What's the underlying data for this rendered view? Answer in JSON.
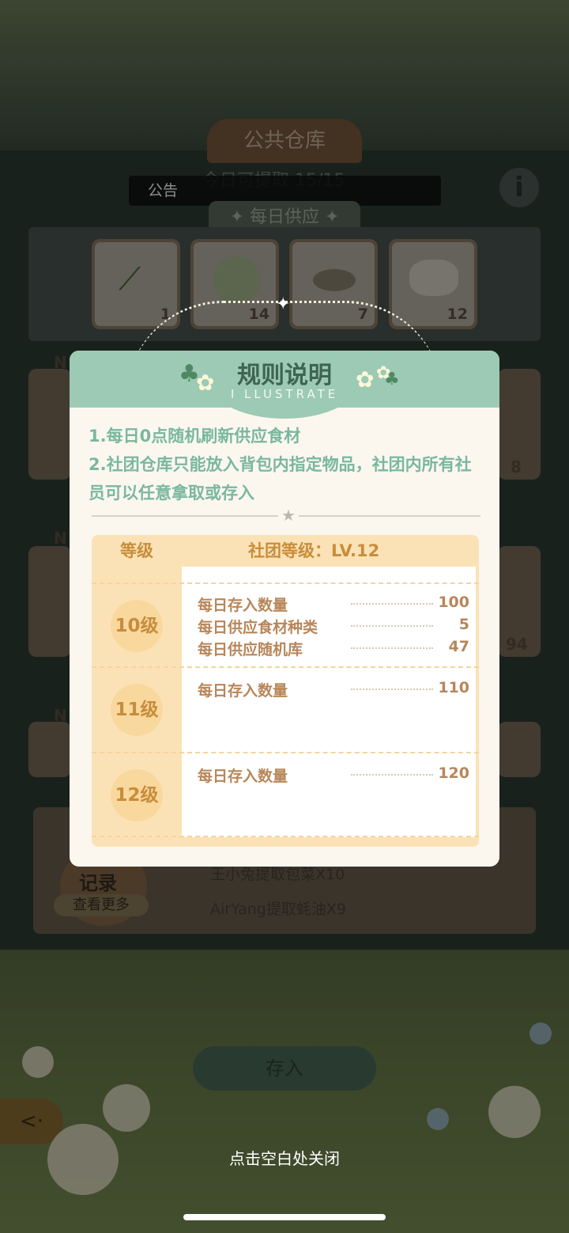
{
  "background": {
    "title": "公共仓库",
    "today_text": "今日可提取 15/15",
    "notice_label": "公告",
    "info_icon": "i",
    "supply_tab": "✦ 每日供应 ✦",
    "supply_slots": [
      {
        "icon": "leek-icon",
        "count": "1"
      },
      {
        "icon": "cabbage-icon",
        "count": "14"
      },
      {
        "icon": "sauce-bowl-icon",
        "count": "7"
      },
      {
        "icon": "cauliflower-icon",
        "count": "12"
      }
    ],
    "side_counts": {
      "left_a": "N",
      "left_b": "N",
      "left_c": "N",
      "right_a": "8",
      "right_b": "94"
    },
    "log_title": "记录",
    "log_more": "查看更多",
    "log_lines": [
      "王小兔提取包菜X10",
      "AirYang提取蚝油X9"
    ],
    "deposit_label": "存入",
    "back_icon": "back-arrow-icon"
  },
  "modal": {
    "title": "规则说明",
    "subtitle": "I LLUSTRATE",
    "rules": [
      "1.每日0点随机刷新供应食材",
      "2.社团仓库只能放入背包内指定物品，社团内所有社员可以任意拿取或存入"
    ],
    "table": {
      "header_level": "等级",
      "header_club": "社团等级：LV.12",
      "rows": [
        {
          "level": "10级",
          "items": [
            {
              "label": "每日存入数量",
              "value": "100"
            },
            {
              "label": "每日供应食材种类",
              "value": "5"
            },
            {
              "label": "每日供应随机库",
              "value": "47"
            }
          ]
        },
        {
          "level": "11级",
          "items": [
            {
              "label": "每日存入数量",
              "value": "110"
            }
          ]
        },
        {
          "level": "12级",
          "items": [
            {
              "label": "每日存入数量",
              "value": "120"
            }
          ]
        }
      ]
    }
  },
  "close_hint": "点击空白处关闭",
  "colors": {
    "accent_green": "#9ccab5",
    "text_green": "#7ab89e",
    "gold": "#c88d3b",
    "cream": "#fbe2b6"
  }
}
